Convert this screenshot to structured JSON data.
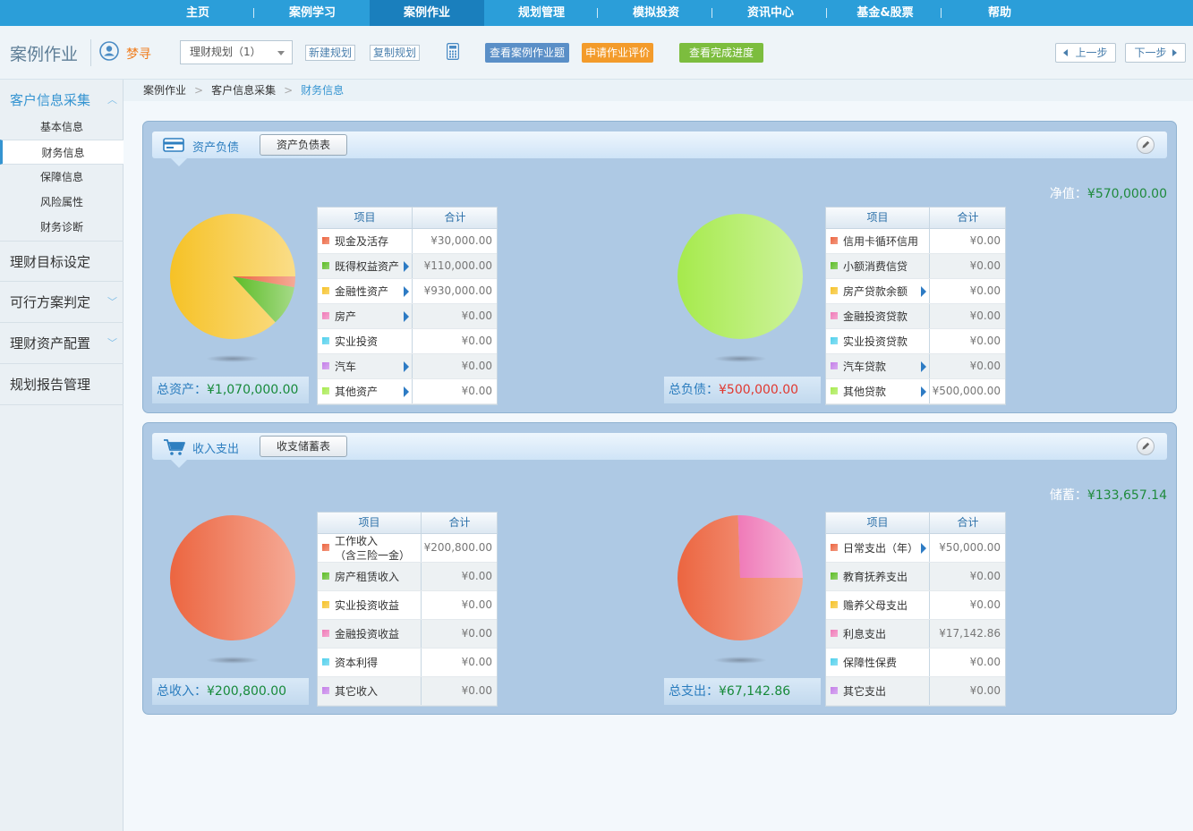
{
  "nav": {
    "items": [
      "主页",
      "案例学习",
      "案例作业",
      "规划管理",
      "模拟投资",
      "资讯中心",
      "基金&股票",
      "帮助"
    ],
    "active_index": 2
  },
  "toolbar": {
    "page_title": "案例作业",
    "user_name": "梦寻",
    "plan_select": "理财规划（1）",
    "new_plan": "新建规划",
    "copy_plan": "复制规划",
    "view_questions": "查看案例作业题",
    "apply_review": "申请作业评价",
    "view_progress": "查看完成进度",
    "prev": "上一步",
    "next": "下一步",
    "colors": {
      "view_questions": "#5a8fc7",
      "apply_review": "#f39b2b",
      "view_progress": "#7cbd3e"
    }
  },
  "sidebar": {
    "groups": [
      {
        "label": "客户信息采集",
        "active": true,
        "children": [
          "基本信息",
          "财务信息",
          "保障信息",
          "风险属性",
          "财务诊断"
        ],
        "active_child": 1
      },
      {
        "label": "理财目标设定"
      },
      {
        "label": "可行方案判定"
      },
      {
        "label": "理财资产配置"
      },
      {
        "label": "规划报告管理"
      }
    ]
  },
  "breadcrumb": [
    "案例作业",
    "客户信息采集",
    "财务信息"
  ],
  "colors": {
    "swatches": [
      "#ec6540",
      "#5cbc25",
      "#f6c226",
      "#ef7ab8",
      "#4fd0ec",
      "#c47fe8",
      "#a6ea4c"
    ],
    "accent": "#3594d1",
    "green_value": "#178a3a",
    "red_value": "#e0372f"
  },
  "table_headers": {
    "item": "项目",
    "total": "合计"
  },
  "balance": {
    "title": "资产负债",
    "button": "资产负债表",
    "summary_label": "净值：",
    "summary_value": "¥570,000.00",
    "assets": {
      "total_label": "总资产：",
      "total_value": "¥1,070,000.00",
      "rows": [
        {
          "label": "现金及活存",
          "value": "¥30,000.00",
          "arrow": false
        },
        {
          "label": "既得权益资产",
          "value": "¥110,000.00",
          "arrow": true
        },
        {
          "label": "金融性资产",
          "value": "¥930,000.00",
          "arrow": true
        },
        {
          "label": "房产",
          "value": "¥0.00",
          "arrow": true
        },
        {
          "label": "实业投资",
          "value": "¥0.00",
          "arrow": false
        },
        {
          "label": "汽车",
          "value": "¥0.00",
          "arrow": true
        },
        {
          "label": "其他资产",
          "value": "¥0.00",
          "arrow": true
        }
      ],
      "pie_values": [
        30000,
        110000,
        930000,
        0,
        0,
        0,
        0
      ]
    },
    "liabilities": {
      "total_label": "总负债：",
      "total_value": "¥500,000.00",
      "rows": [
        {
          "label": "信用卡循环信用",
          "value": "¥0.00",
          "arrow": false
        },
        {
          "label": "小额消费信贷",
          "value": "¥0.00",
          "arrow": false
        },
        {
          "label": "房产贷款余额",
          "value": "¥0.00",
          "arrow": true
        },
        {
          "label": "金融投资贷款",
          "value": "¥0.00",
          "arrow": false
        },
        {
          "label": "实业投资贷款",
          "value": "¥0.00",
          "arrow": false
        },
        {
          "label": "汽车贷款",
          "value": "¥0.00",
          "arrow": true
        },
        {
          "label": "其他贷款",
          "value": "¥500,000.00",
          "arrow": true
        }
      ],
      "pie_values": [
        0,
        0,
        0,
        0,
        0,
        0,
        500000
      ]
    }
  },
  "cashflow": {
    "title": "收入支出",
    "button": "收支储蓄表",
    "summary_label": "储蓄：",
    "summary_value": "¥133,657.14",
    "income": {
      "total_label": "总收入：",
      "total_value": "¥200,800.00",
      "rows": [
        {
          "label": "工作收入\n（含三险一金）",
          "value": "¥200,800.00",
          "arrow": false
        },
        {
          "label": "房产租赁收入",
          "value": "¥0.00",
          "arrow": false
        },
        {
          "label": "实业投资收益",
          "value": "¥0.00",
          "arrow": false
        },
        {
          "label": "金融投资收益",
          "value": "¥0.00",
          "arrow": false
        },
        {
          "label": "资本利得",
          "value": "¥0.00",
          "arrow": false
        },
        {
          "label": "其它收入",
          "value": "¥0.00",
          "arrow": false
        }
      ],
      "pie_values": [
        200800,
        0,
        0,
        0,
        0,
        0
      ]
    },
    "expense": {
      "total_label": "总支出：",
      "total_value": "¥67,142.86",
      "rows": [
        {
          "label": "日常支出（年）",
          "value": "¥50,000.00",
          "arrow": true
        },
        {
          "label": "教育抚养支出",
          "value": "¥0.00",
          "arrow": false
        },
        {
          "label": "赡养父母支出",
          "value": "¥0.00",
          "arrow": false
        },
        {
          "label": "利息支出",
          "value": "¥17,142.86",
          "arrow": false
        },
        {
          "label": "保障性保费",
          "value": "¥0.00",
          "arrow": false
        },
        {
          "label": "其它支出",
          "value": "¥0.00",
          "arrow": false
        }
      ],
      "pie_values": [
        50000,
        0,
        0,
        17142.86,
        0,
        0
      ]
    }
  }
}
